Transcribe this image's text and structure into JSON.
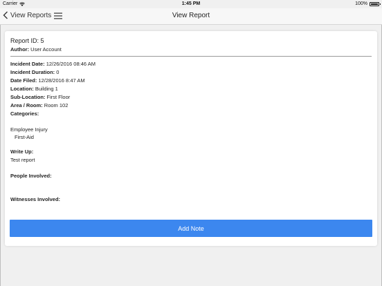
{
  "status_bar": {
    "carrier": "Carrier",
    "time": "1:45 PM",
    "battery": "100%"
  },
  "nav": {
    "back_label": "View Reports",
    "title": "View Report",
    "icons": [
      "chevron-left-icon",
      "hamburger-menu-icon",
      "wifi-icon",
      "battery-icon"
    ]
  },
  "report": {
    "id_label": "Report ID: 5",
    "author_label": "Author:",
    "author_value": "User Account",
    "fields": [
      {
        "label": "Incident Date:",
        "value": "12/26/2016 08:46 AM"
      },
      {
        "label": "Incident Duration:",
        "value": "0"
      },
      {
        "label": "Date Filed:",
        "value": "12/28/2016 8:47 AM"
      },
      {
        "label": "Location:",
        "value": "Building 1"
      },
      {
        "label": "Sub-Location:",
        "value": "First Floor"
      },
      {
        "label": "Area / Room:",
        "value": "Room 102"
      },
      {
        "label": "Categories:",
        "value": ""
      }
    ],
    "categories": {
      "main": "Employee Injury",
      "sub": "First-Aid"
    },
    "write_up_label": "Write Up:",
    "write_up_value": "Test report",
    "people_label": "People Involved:",
    "witnesses_label": "Witnesses Involved:"
  },
  "actions": {
    "add_note_label": "Add Note"
  },
  "colors": {
    "accent": "#3c87ef",
    "background": "#f0f0f0",
    "card": "#ffffff"
  }
}
